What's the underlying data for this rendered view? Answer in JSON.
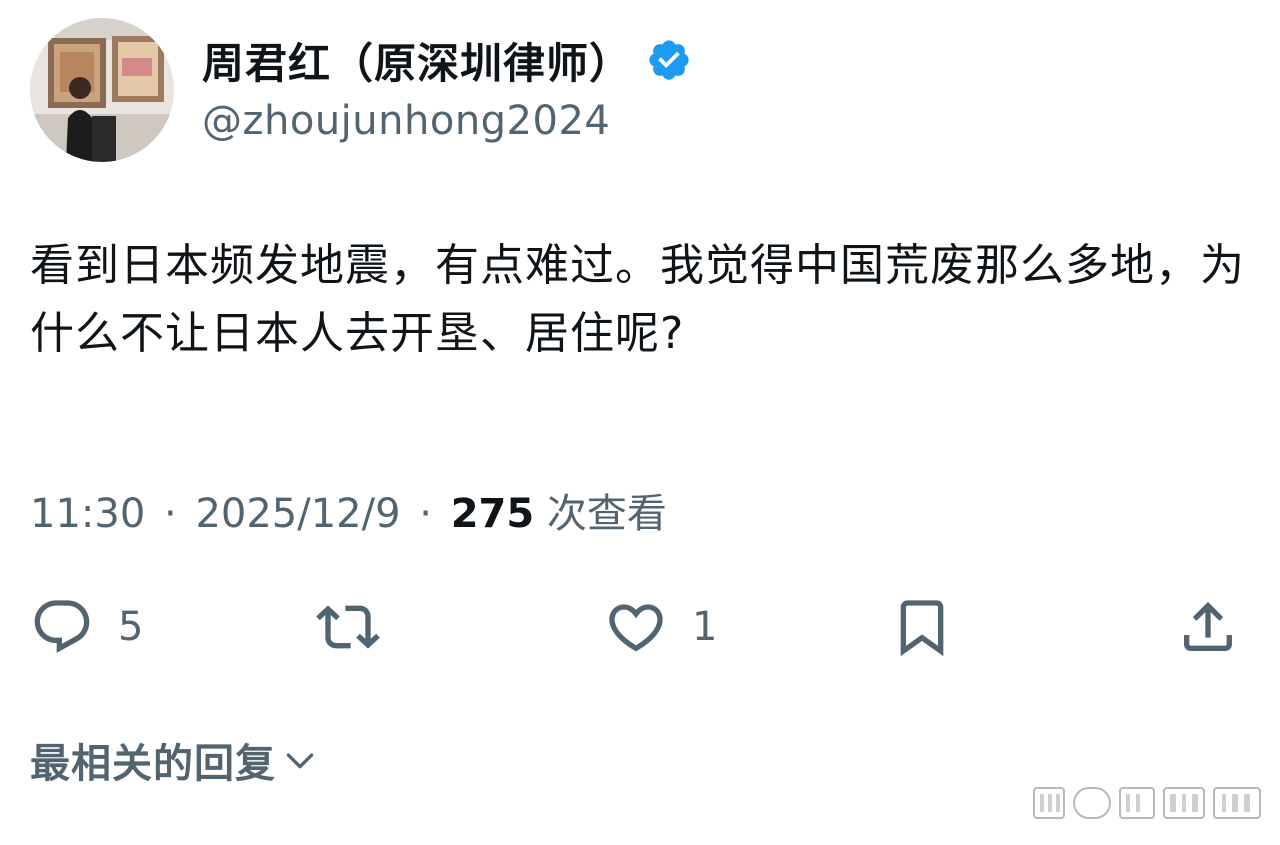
{
  "author": {
    "display_name": "周君红（原深圳律师）",
    "handle": "@zhoujunhong2024",
    "verified": true
  },
  "tweet": {
    "text": "看到日本频发地震，有点难过。我觉得中国荒废那么多地，为什么不让日本人去开垦、居住呢?",
    "time": "11:30",
    "separator": "·",
    "date": "2025/12/9",
    "views_count": "275",
    "views_label": "次查看"
  },
  "actions": {
    "reply_count": "5",
    "repost_count": "",
    "like_count": "1"
  },
  "replies": {
    "sort_label": "最相关的回复"
  },
  "colors": {
    "text": "#0f1419",
    "secondary": "#536471",
    "verified": "#1d9bf0"
  },
  "icons": [
    "verified-badge-icon",
    "reply-icon",
    "repost-icon",
    "like-icon",
    "bookmark-icon",
    "share-icon",
    "chevron-down-icon"
  ]
}
